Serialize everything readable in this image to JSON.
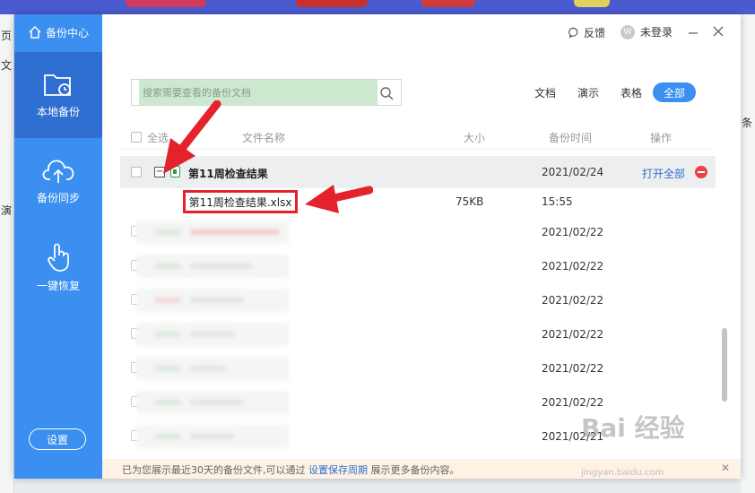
{
  "background": {
    "left_fragments": [
      "页",
      "文",
      "演"
    ],
    "right_fragments": [
      "条"
    ]
  },
  "sidebar": {
    "brand": "备份中心",
    "items": [
      {
        "label": "本地备份",
        "icon": "local-backup-icon",
        "active": true
      },
      {
        "label": "备份同步",
        "icon": "cloud-upload-icon",
        "active": false
      },
      {
        "label": "一键恢复",
        "icon": "hand-tap-icon",
        "active": false
      }
    ],
    "settings": "设置"
  },
  "header": {
    "feedback": "反馈",
    "login": "未登录"
  },
  "search": {
    "placeholder": "搜索需要查看的备份文档"
  },
  "filters": [
    "文档",
    "演示",
    "表格",
    "全部"
  ],
  "active_filter": "全部",
  "table": {
    "headers": {
      "select_all": "全选",
      "name": "文件名称",
      "size": "大小",
      "time": "备份时间",
      "action": "操作"
    },
    "group": {
      "title": "第11周检查结果",
      "date": "2021/02/24",
      "action": "打开全部"
    },
    "file": {
      "name": "第11周检查结果.xlsx",
      "size": "75KB",
      "time": "15:55"
    },
    "rows": [
      {
        "date": "2021/02/22"
      },
      {
        "date": "2021/02/22"
      },
      {
        "date": "2021/02/22"
      },
      {
        "date": "2021/02/22"
      },
      {
        "date": "2021/02/22"
      },
      {
        "date": "2021/02/22"
      },
      {
        "date": "2021/02/21"
      }
    ]
  },
  "footer": {
    "text_before": "已为您展示最近30天的备份文件,可以通过",
    "link": "设置保存周期",
    "text_after": "展示更多备份内容。"
  },
  "colors": {
    "sidebar": "#3a8ff0",
    "sidebar_active": "#2f6fd1",
    "accent": "#3a8ff0",
    "highlight": "#e3222c"
  }
}
